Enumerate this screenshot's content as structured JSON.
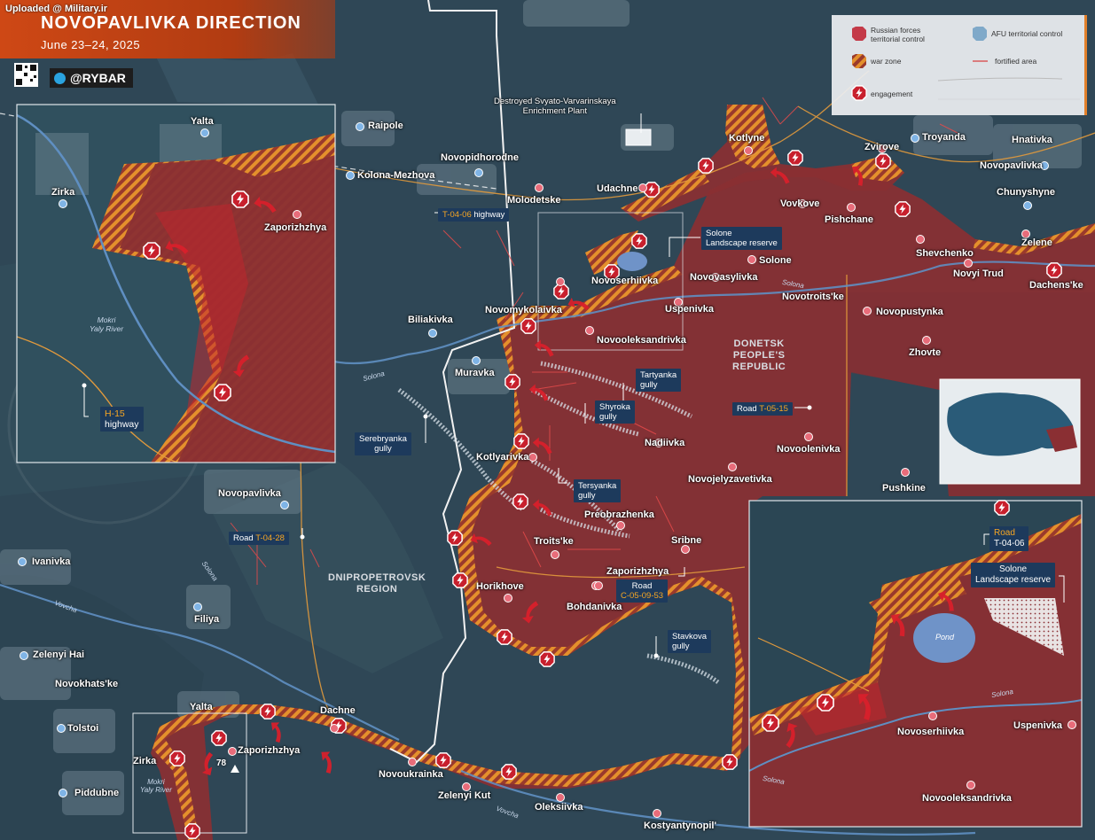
{
  "header": {
    "uploaded": "Uploaded @ Military.ir",
    "title": "NOVOPAVLIVKA DIRECTION",
    "date": "June 23–24, 2025",
    "brand": "@RYBAR"
  },
  "legend": {
    "russian_forces": "Russian forces territorial control",
    "afu": "AFU territorial control",
    "war_zone": "war zone",
    "fortified": "fortified area",
    "engagement": "engagement"
  },
  "colors": {
    "russian_area": "#8a2f33",
    "war_zone_stripe": "#e4902c",
    "afu_area": "#2f4b5a",
    "header_orange": "#ce4815",
    "label_box": "#1d3a5c",
    "engagement_red": "#c8202d"
  },
  "icons": [
    "settlement-marker-icon",
    "engagement-icon",
    "attack-arrow-icon",
    "qr-code-icon",
    "telegram-icon"
  ],
  "places": {
    "raipole": "Raipole",
    "kolona_mezhova": "Kolona-Mezhova",
    "novopidhorodne": "Novopidhorodne",
    "molodetske": "Molodetske",
    "udachne": "Udachne",
    "kotlyne": "Kotlyne",
    "zvirove": "Zvirove",
    "troyanda": "Troyanda",
    "hnativka": "Hnativka",
    "novopavlivka_ne": "Novopavlivka",
    "chunyshyne": "Chunyshyne",
    "vovkove": "Vovkove",
    "pishchane": "Pishchane",
    "zelene": "Zelene",
    "shevchenko": "Shevchenko",
    "novyi_trud": "Novyi Trud",
    "dachens_ke": "Dachens'ke",
    "solone": "Solone",
    "novovasylivka": "Novovasylivka",
    "novotroits_ke": "Novotroits'ke",
    "novoserhiivka": "Novoserhiivka",
    "uspenivka": "Uspenivka",
    "novopustynka": "Novopustynka",
    "novomykolaivka": "Novomykolaivka",
    "novooleksandrivka": "Novooleksandrivka",
    "biliakivka": "Biliakivka",
    "muravka": "Muravka",
    "zhovte": "Zhovte",
    "nadiivka": "Nadiivka",
    "novoolenivka": "Novoolenivka",
    "novojelyzavetivka": "Novojelyzavetivka",
    "pushkine": "Pushkine",
    "kotlyarivka": "Kotlyarivka",
    "preobrazhenka": "Preobrazhenka",
    "troits_ke": "Troits'ke",
    "sribne": "Sribne",
    "zaporizhzhya": "Zaporizhzhya",
    "horikhove": "Horikhove",
    "bohdanivka": "Bohdanivka",
    "novopavlivka": "Novopavlivka",
    "ivanivka": "Ivanivka",
    "filiya": "Filiya",
    "zelenyi_hai": "Zelenyi Hai",
    "novokhats_ke": "Novokhats'ke",
    "tolstoi": "Tolstoi",
    "piddubne": "Piddubne",
    "yalta": "Yalta",
    "zirka": "Zirka",
    "dachne": "Dachne",
    "novoukrainka": "Novoukrainka",
    "zelenyi_kut": "Zelenyi Kut",
    "oleksiivka": "Oleksiivka",
    "kostyantynopil": "Kostyantynopil'",
    "height_78": "78"
  },
  "regions": {
    "dnr_1": "DONETSK",
    "dnr_2": "PEOPLE'S",
    "dnr_3": "REPUBLIC",
    "dnipro_1": "DNIPROPETROVSK",
    "dnipro_2": "REGION"
  },
  "rivers": {
    "solona": "Solona",
    "vovcha": "Vovcha",
    "mokri_1": "Mokri",
    "mokri_2": "Yaly River"
  },
  "callouts": {
    "plant_1": "Destroyed Svyato-Varvarinskaya",
    "plant_2": "Enrichment Plant",
    "t0406_road": "T-04-06",
    "t0406_suffix": " highway",
    "reserve_1": "Solone",
    "reserve_2": "Landscape reserve",
    "tartyanka_1": "Tartyanka",
    "tartyanka_2": "gully",
    "shyroka_1": "Shyroka",
    "shyroka_2": "gully",
    "road_word": "Road ",
    "t0515": "T-05-15",
    "serebryanka_1": "Serebryanka",
    "serebryanka_2": "gully",
    "tersyanka_1": "Tersyanka",
    "tersyanka_2": "gully",
    "t0428": "T-04-28",
    "c050953_road": "Road",
    "c050953": "C-05-09-53",
    "stavkova_1": "Stavkova",
    "stavkova_2": "gully",
    "h15": "H-15",
    "h15_suffix": "highway"
  },
  "inset_left": {
    "yalta": "Yalta",
    "zirka": "Zirka",
    "zaporizhzhya": "Zaporizhzhya",
    "mokri_1": "Mokri",
    "mokri_2": "Yaly River"
  },
  "inset_right": {
    "road_word": "Road",
    "road": "T-04-06",
    "reserve_1": "Solone",
    "reserve_2": "Landscape reserve",
    "pond": "Pond",
    "solona": "Solona",
    "novoserhiivka": "Novoserhiivka",
    "uspenivka": "Uspenivka",
    "novooleksandrivka": "Novooleksandrivka"
  }
}
